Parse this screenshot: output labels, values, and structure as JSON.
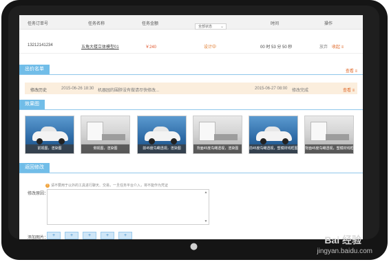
{
  "table": {
    "headers": {
      "order_no": "任务订单号",
      "task_name": "任务名称",
      "amount": "任务金额",
      "status_filter": "全部状态",
      "time": "时间",
      "action": "操作"
    },
    "row": {
      "order_no": "13212141234",
      "task_name": "五角大楼立体模型01",
      "amount": "￥240",
      "status": "设计中",
      "time": "00 时  53 分  50 秒",
      "action_delete": "放弃",
      "action_accept": "收起 ≡"
    }
  },
  "bid_list": {
    "title": "出价名单",
    "more": "查看 ≡"
  },
  "history": {
    "label": "修改历史",
    "date1": "2015-06-26 18:30",
    "note1": "机器园的围脖没有做请尽快修改...",
    "date2": "2015-06-27 08:00",
    "note2": "修改完成",
    "more": "查看 ≡"
  },
  "renders": {
    "title": "效果图",
    "items": [
      {
        "caption": "前视图，渲染图",
        "kind": "car"
      },
      {
        "caption": "侧视图，渲染图",
        "kind": "room"
      },
      {
        "caption": "前45度鸟瞰透视，渲染图",
        "kind": "car"
      },
      {
        "caption": "背面45度鸟瞰透视，渲染图",
        "kind": "room"
      },
      {
        "caption": "前45度鸟瞰透视，塑模材线框图",
        "kind": "car"
      },
      {
        "caption": "背面45度鸟瞰透视，塑模材线框图",
        "kind": "room"
      }
    ]
  },
  "revise": {
    "title": "返回修改",
    "tip": "请不要用于以外的工具进行聊天、交易，一旦任务平台介入，将不能作为凭证",
    "reason_label": "修改原因：",
    "add_label": "添加图片："
  },
  "device": {
    "apple_glyph": "",
    "watermark_main": "Bai 经验",
    "watermark_url": "jingyan.baidu.com"
  }
}
